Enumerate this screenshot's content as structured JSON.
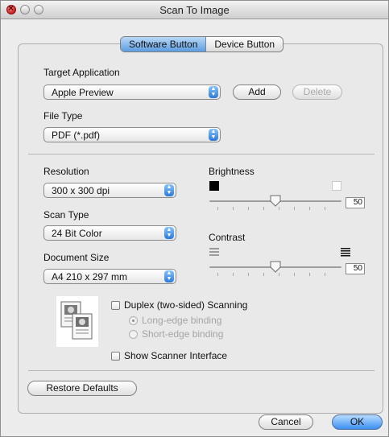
{
  "window": {
    "title": "Scan To Image"
  },
  "tabs": [
    {
      "label": "Software Button",
      "selected": true
    },
    {
      "label": "Device Button",
      "selected": false
    }
  ],
  "target_application": {
    "label": "Target Application",
    "value": "Apple Preview",
    "add_label": "Add",
    "delete_label": "Delete"
  },
  "file_type": {
    "label": "File Type",
    "value": "PDF (*.pdf)"
  },
  "resolution": {
    "label": "Resolution",
    "value": "300 x 300 dpi"
  },
  "scan_type": {
    "label": "Scan Type",
    "value": "24 Bit Color"
  },
  "document_size": {
    "label": "Document Size",
    "value": "A4  210 x 297 mm"
  },
  "brightness": {
    "label": "Brightness",
    "value": "50",
    "level": 0.5
  },
  "contrast": {
    "label": "Contrast",
    "value": "50",
    "level": 0.5
  },
  "options": {
    "duplex_label": "Duplex (two-sided) Scanning",
    "duplex_checked": false,
    "long_edge_label": "Long-edge binding",
    "short_edge_label": "Short-edge binding",
    "binding_selected": "long-edge",
    "show_scanner_label": "Show Scanner Interface",
    "show_scanner_checked": false
  },
  "footer": {
    "restore_label": "Restore Defaults",
    "cancel_label": "Cancel",
    "ok_label": "OK"
  },
  "colors": {
    "accent": "#5d9de0",
    "panel": "#e9e9e9",
    "window": "#ececec"
  }
}
